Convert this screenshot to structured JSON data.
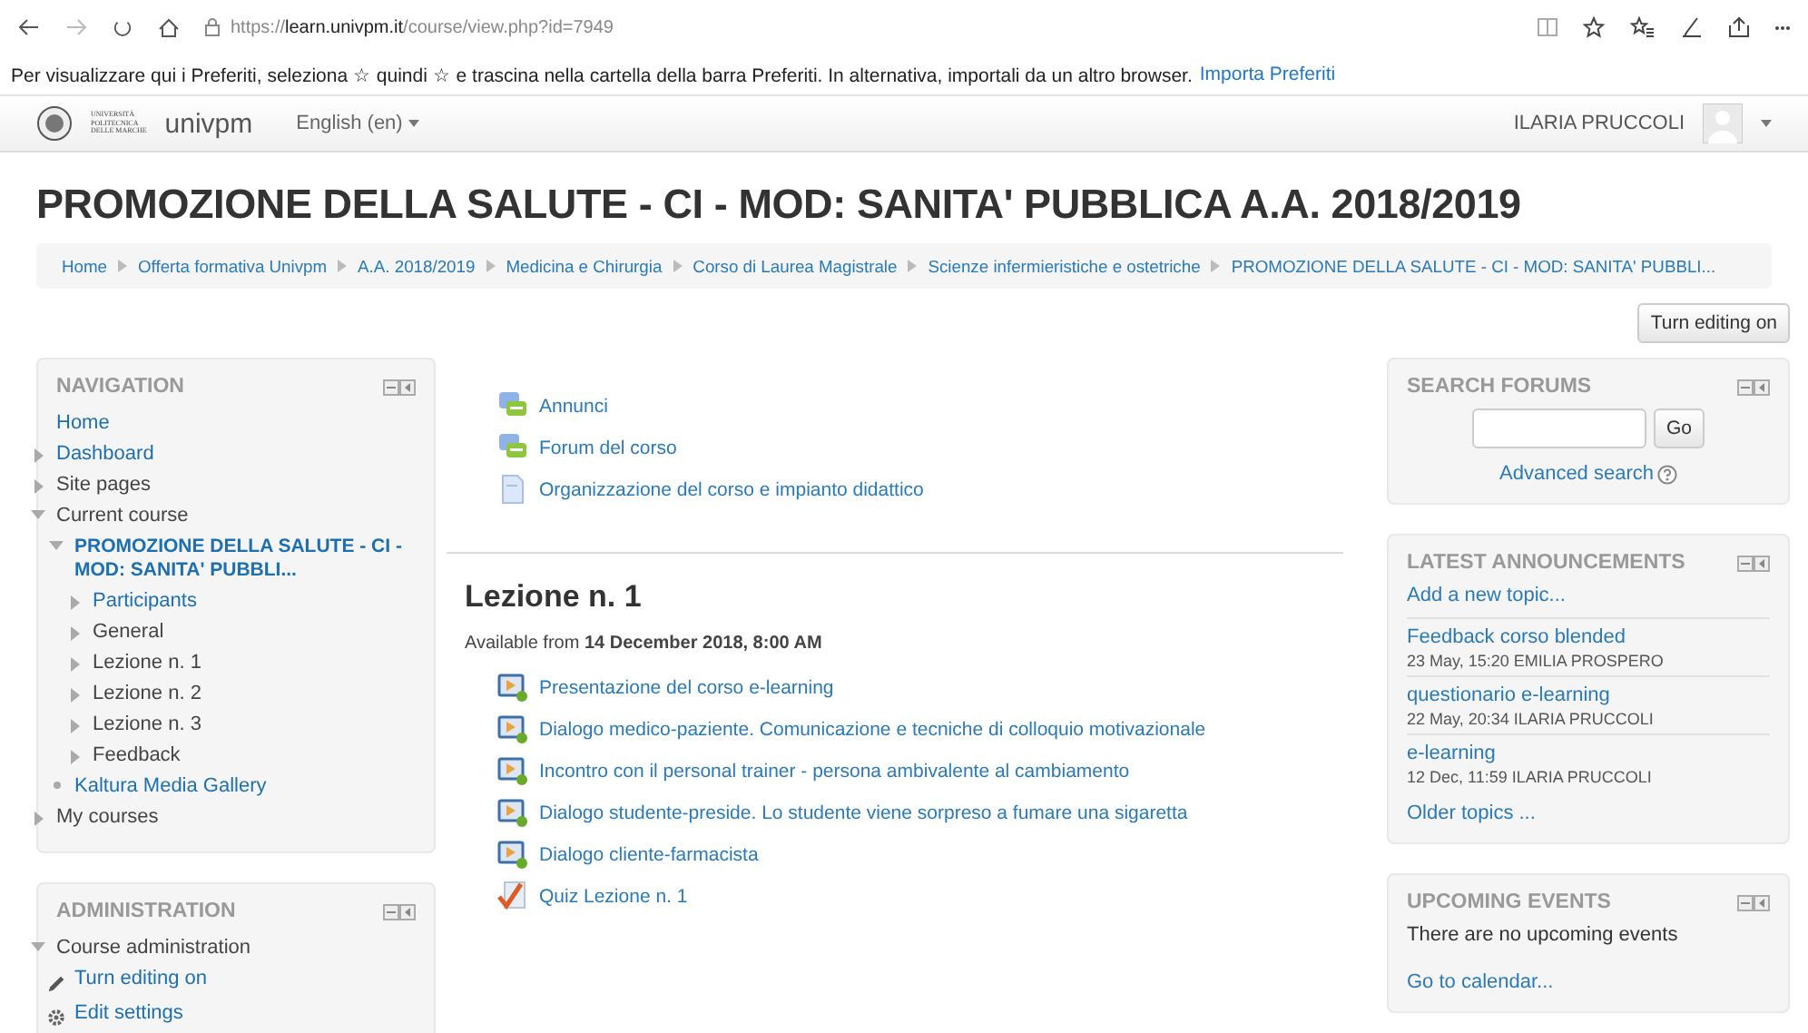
{
  "browser": {
    "url": "https://**learn.univpm.it**/course/view.php?id=7949"
  },
  "favorites_bar": {
    "message": "Per visualizzare qui i Preferiti, seleziona ☆ quindi ☆ e trascina nella cartella della barra Preferiti. In alternativa, importali da un altro browser.",
    "link": "Importa Preferiti"
  },
  "navbar": {
    "logo_lines": [
      "UNIVERSITÀ",
      "POLITECNICA",
      "DELLE MARCHE"
    ],
    "site_name": "univpm",
    "language": "English (en)",
    "user": "ILARIA PRUCCOLI"
  },
  "page_title": "PROMOZIONE DELLA SALUTE - CI - MOD: SANITA' PUBBLICA A.A. 2018/2019",
  "breadcrumb": [
    "Home",
    "Offerta formativa Univpm",
    "A.A. 2018/2019",
    "Medicina e Chirurgia",
    "Corso di Laurea Magistrale",
    "Scienze infermieristiche e ostetriche",
    "PROMOZIONE DELLA SALUTE - CI - MOD: SANITA' PUBBLI..."
  ],
  "edit_button": "Turn editing on",
  "navigation": {
    "title": "NAVIGATION",
    "items": [
      {
        "label": "Home",
        "kind": "plain",
        "link": true
      },
      {
        "label": "Dashboard",
        "kind": "collapsed",
        "link": true
      },
      {
        "label": "Site pages",
        "kind": "collapsed",
        "link": false
      },
      {
        "label": "Current course",
        "kind": "expanded",
        "link": false,
        "children": [
          {
            "label": "PROMOZIONE DELLA SALUTE - CI - MOD: SANITA' PUBBLI...",
            "kind": "expanded",
            "link": true,
            "bold": true,
            "children": [
              {
                "label": "Participants",
                "kind": "collapsed",
                "link": true
              },
              {
                "label": "General",
                "kind": "collapsed",
                "link": false
              },
              {
                "label": "Lezione n. 1",
                "kind": "collapsed",
                "link": false
              },
              {
                "label": "Lezione n. 2",
                "kind": "collapsed",
                "link": false
              },
              {
                "label": "Lezione n. 3",
                "kind": "collapsed",
                "link": false
              },
              {
                "label": "Feedback",
                "kind": "collapsed",
                "link": false
              }
            ]
          },
          {
            "label": "Kaltura Media Gallery",
            "kind": "bullet",
            "link": true
          }
        ]
      },
      {
        "label": "My courses",
        "kind": "collapsed",
        "link": false
      }
    ]
  },
  "administration": {
    "title": "ADMINISTRATION",
    "items": [
      {
        "label": "Course administration",
        "kind": "expanded",
        "link": false,
        "children": [
          {
            "label": "Turn editing on",
            "kind": "pencil",
            "link": true
          },
          {
            "label": "Edit settings",
            "kind": "gear",
            "link": true
          }
        ]
      }
    ]
  },
  "top_activities": [
    {
      "label": "Annunci",
      "kind": "forum"
    },
    {
      "label": "Forum del corso",
      "kind": "forum"
    },
    {
      "label": "Organizzazione del corso e impianto didattico",
      "kind": "page"
    }
  ],
  "section": {
    "title": "Lezione n. 1",
    "availability": "Available from **14 December 2018, 8:00 AM**",
    "activities": [
      {
        "label": "Presentazione del corso e-learning",
        "kind": "video"
      },
      {
        "label": "Dialogo medico-paziente. Comunicazione e tecniche di colloquio motivazionale",
        "kind": "video"
      },
      {
        "label": "Incontro con il personal trainer - persona ambivalente al cambiamento",
        "kind": "video"
      },
      {
        "label": "Dialogo studente-preside. Lo studente viene sorpreso a fumare una sigaretta",
        "kind": "video"
      },
      {
        "label": "Dialogo cliente-farmacista",
        "kind": "video"
      },
      {
        "label": "Quiz Lezione n. 1",
        "kind": "quiz"
      }
    ]
  },
  "search_forums": {
    "title": "SEARCH FORUMS",
    "button": "Go",
    "advanced": "Advanced search"
  },
  "latest_announcements": {
    "title": "LATEST ANNOUNCEMENTS",
    "add": "Add a new topic...",
    "posts": [
      {
        "title": "Feedback corso blended",
        "meta": "23 May, 15:20  EMILIA PROSPERO"
      },
      {
        "title": "questionario e-learning",
        "meta": "22 May, 20:34  ILARIA PRUCCOLI"
      },
      {
        "title": "e-learning",
        "meta": "12 Dec, 11:59  ILARIA PRUCCOLI"
      }
    ],
    "older": "Older topics ..."
  },
  "upcoming_events": {
    "title": "UPCOMING EVENTS",
    "message": "There are no upcoming events",
    "link": "Go to calendar..."
  }
}
